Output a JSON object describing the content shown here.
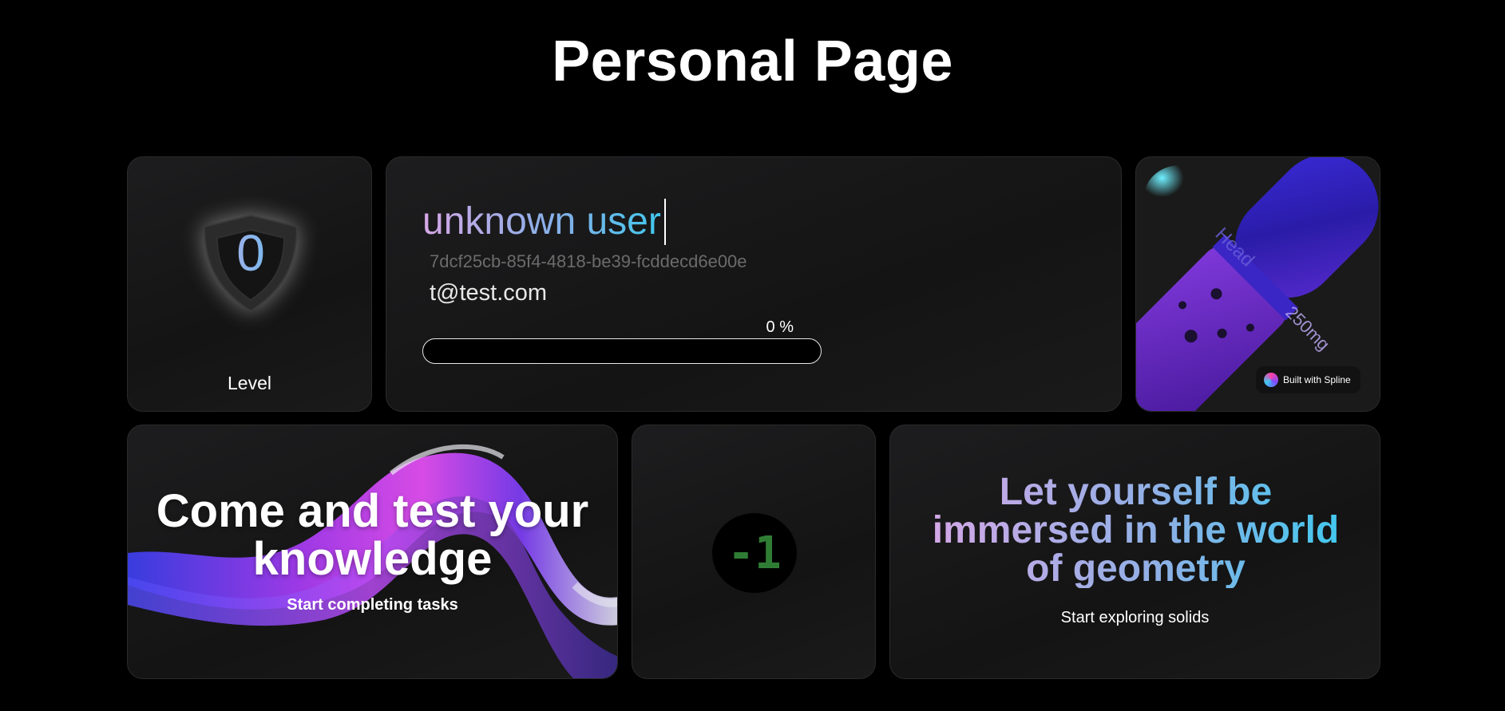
{
  "page": {
    "title": "Personal Page"
  },
  "level_card": {
    "level_value": "0",
    "label": "Level",
    "icon": "shield-icon"
  },
  "profile": {
    "user_name": "unknown user",
    "user_id": "7dcf25cb-85f4-4818-be39-fcddecd6e00e",
    "email": "t@test.com",
    "progress_text": "0 %",
    "progress_fraction": 0
  },
  "pill_card": {
    "pill_text_top": "Head",
    "pill_text_bottom": "250mg",
    "badge_label": "Built with Spline",
    "badge_icon": "spline-logo-icon"
  },
  "tasks_card": {
    "heading": "Come and test your knowledge",
    "subtitle": "Start completing tasks"
  },
  "counter_card": {
    "value": "-1"
  },
  "geometry_card": {
    "heading": "Let yourself be immersed in the world of geometry",
    "subtitle": "Start exploring solids"
  },
  "colors": {
    "background": "#000000",
    "card": "#1a1a1a",
    "gradient_start": "#d6a7e6",
    "gradient_end": "#3fc9ee",
    "counter_green": "#2f7d34"
  }
}
